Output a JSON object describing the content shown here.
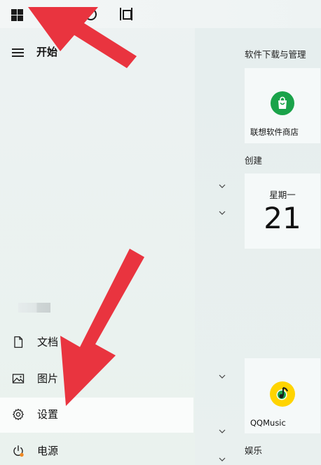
{
  "start_menu": {
    "title": "开始",
    "user_name_redacted": "",
    "nav": {
      "documents": "文档",
      "pictures": "图片",
      "settings": "设置",
      "power": "电源"
    }
  },
  "tiles": {
    "group_software": "软件下载与管理",
    "lenovo_store": "联想软件商店",
    "group_create": "创建",
    "calendar_weekday": "星期一",
    "calendar_day": "21",
    "qqmusic": "QQMusic",
    "group_entertainment": "娱乐"
  },
  "icons": {
    "windows": "windows-logo-icon",
    "search": "search-icon",
    "task_view": "task-view-icon",
    "hamburger": "hamburger-menu-icon",
    "document": "document-icon",
    "picture": "picture-icon",
    "gear": "gear-icon",
    "power": "power-icon"
  },
  "colors": {
    "annotation_arrow": "#e9343f",
    "lenovo_green": "#1aa34a",
    "qq_yellow": "#ffd400",
    "power_badge": "#f08a24"
  }
}
